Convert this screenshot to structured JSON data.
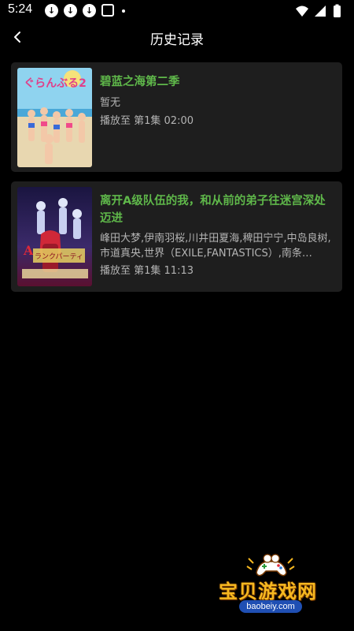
{
  "status_bar": {
    "time": "5:24",
    "notification_icons": [
      "download-icon",
      "download-icon",
      "download-icon",
      "gallery-icon",
      "dot-icon"
    ],
    "system_icons": [
      "wifi-icon",
      "signal-icon",
      "battery-icon"
    ]
  },
  "header": {
    "back_icon": "chevron-left-icon",
    "title": "历史记录"
  },
  "history": [
    {
      "title": "碧蓝之海第二季",
      "cast": "暂无",
      "progress": "播放至 第1集 02:00",
      "cover_colors": [
        "#8fd3ef",
        "#e8d7b0"
      ]
    },
    {
      "title": "离开A级队伍的我，和从前的弟子往迷宫深处迈进",
      "cast": "峰田大梦,伊南羽桜,川井田夏海,稗田宁宁,中岛良树,市道真央,世界（EXILE,FANTASTICS）,南条…",
      "progress": "播放至 第1集 11:13",
      "cover_colors": [
        "#2a1b4a",
        "#c02040"
      ]
    }
  ],
  "watermark": {
    "text": "宝贝游戏网",
    "url": "baobeiy.com"
  },
  "colors": {
    "background": "#000000",
    "card": "#1e1e1e",
    "title_accent": "#5fb84a",
    "meta_text": "#b4b4b4"
  }
}
